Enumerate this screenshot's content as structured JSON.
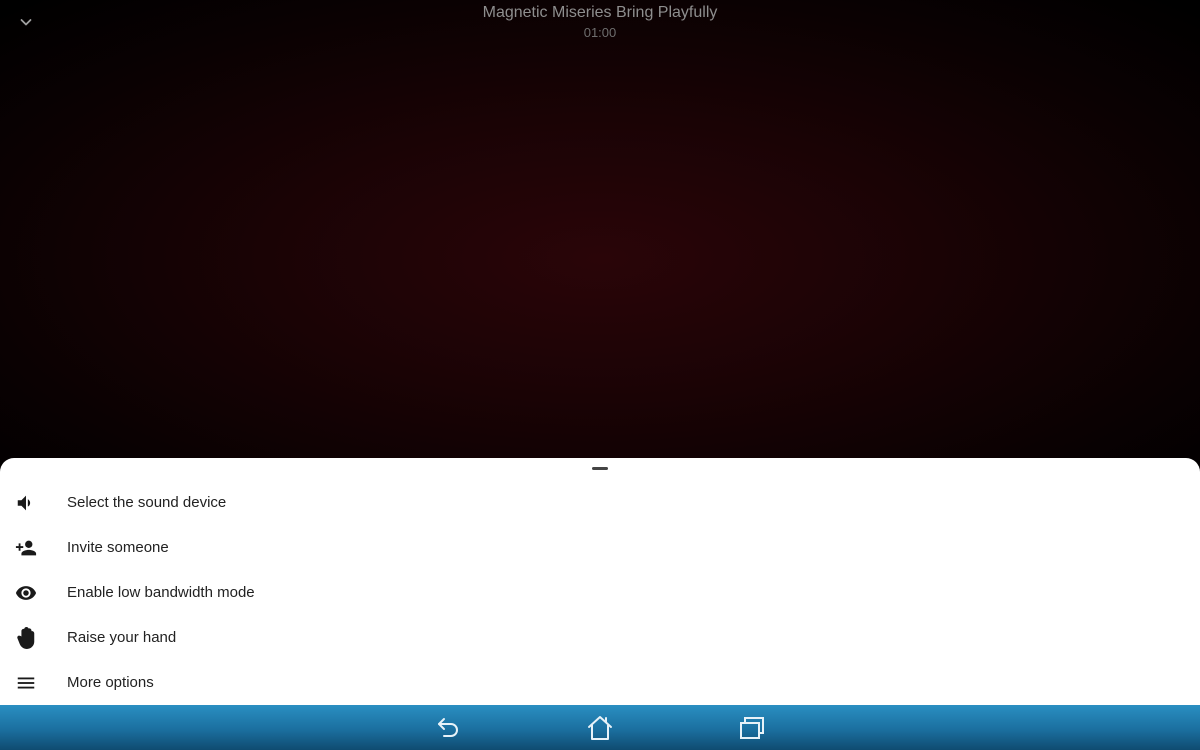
{
  "meeting": {
    "title": "Magnetic Miseries Bring Playfully",
    "timer": "01:00"
  },
  "header": {
    "collapse_icon": "chevron-down-icon"
  },
  "sheet": {
    "items": [
      {
        "label": "Select the sound device",
        "icon": "volume-icon"
      },
      {
        "label": "Invite someone",
        "icon": "add-person-icon"
      },
      {
        "label": "Enable low bandwidth mode",
        "icon": "eye-icon"
      },
      {
        "label": "Raise your hand",
        "icon": "hand-icon"
      },
      {
        "label": "More options",
        "icon": "menu-icon"
      }
    ]
  },
  "nav": {
    "back_icon": "back-icon",
    "home_icon": "home-icon",
    "recents_icon": "recents-icon"
  },
  "colors": {
    "nav_bar": "#1b6f9f",
    "sheet_bg": "#ffffff",
    "video_bg": "#1a0305"
  }
}
